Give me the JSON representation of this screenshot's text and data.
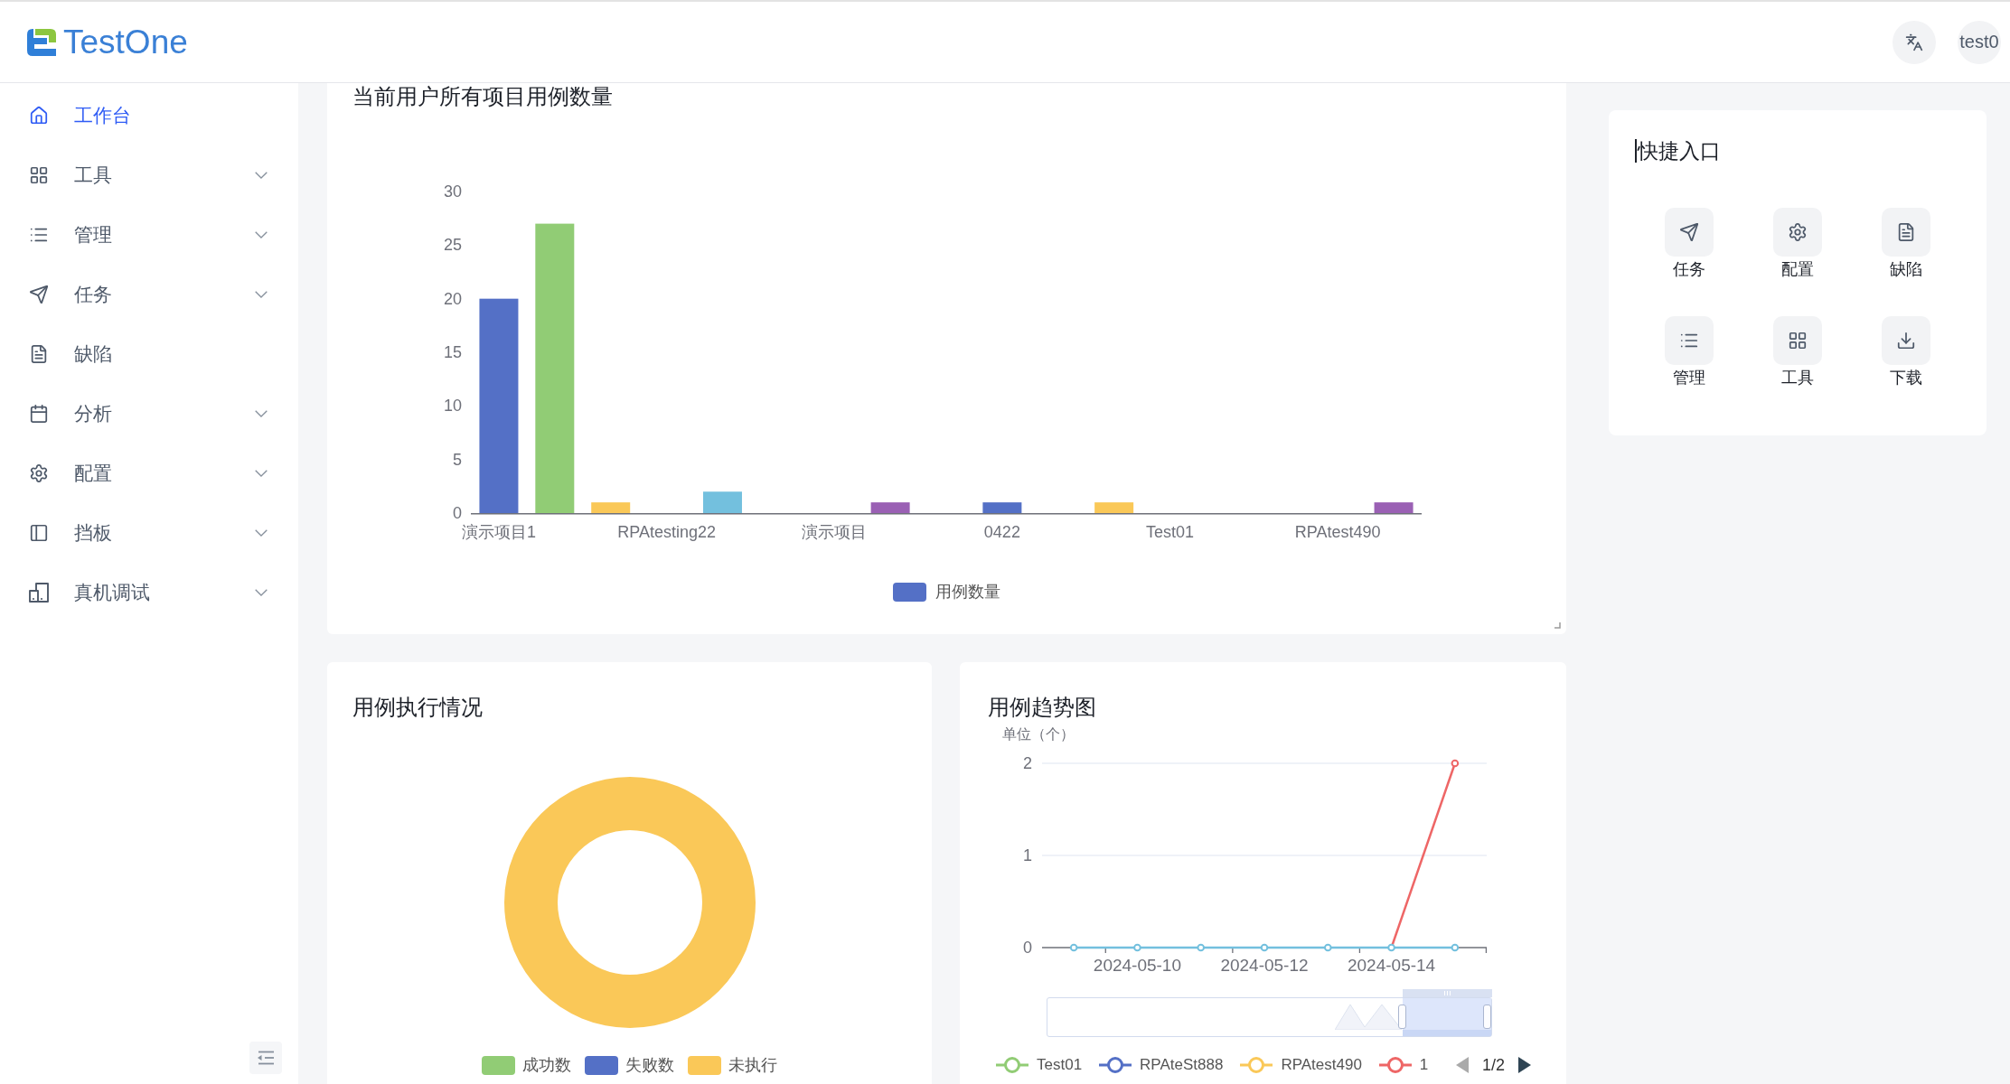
{
  "header": {
    "logo_text": "TestOne",
    "user": "test0"
  },
  "sidebar": {
    "items": [
      {
        "label": "工作台",
        "kind": "link",
        "selected": true
      },
      {
        "label": "工具",
        "kind": "submenu",
        "selected": false
      },
      {
        "label": "管理",
        "kind": "submenu",
        "selected": false
      },
      {
        "label": "任务",
        "kind": "submenu",
        "selected": false
      },
      {
        "label": "缺陷",
        "kind": "link",
        "selected": false
      },
      {
        "label": "分析",
        "kind": "submenu",
        "selected": false
      },
      {
        "label": "配置",
        "kind": "submenu",
        "selected": false
      },
      {
        "label": "挡板",
        "kind": "submenu",
        "selected": false
      },
      {
        "label": "真机调试",
        "kind": "submenu",
        "selected": false
      }
    ]
  },
  "case_count_card": {
    "chart_data": {
      "type": "bar",
      "title": "当前用户所有项目用例数量",
      "categories": [
        "演示项目1",
        null,
        null,
        "RPAtesting22",
        null,
        null,
        "演示项目",
        null,
        null,
        "0422",
        null,
        null,
        "Test01",
        null,
        null,
        "RPAtest490",
        null
      ],
      "ylim": [
        0,
        30
      ],
      "yticks": [
        0,
        5,
        10,
        15,
        20,
        25,
        30
      ],
      "series": [
        {
          "name": "用例数量",
          "color": "#5470c6",
          "values": [
            20,
            27,
            1,
            0,
            2,
            0,
            0,
            1,
            0,
            1,
            0,
            1,
            0,
            0,
            0,
            0,
            1
          ],
          "colors": [
            "#5470c6",
            "#91cc75",
            "#fac858",
            null,
            "#73c0de",
            null,
            null,
            "#9a60b4",
            null,
            "#5470c6",
            null,
            "#fac858",
            null,
            null,
            null,
            null,
            "#9a60b4"
          ]
        }
      ]
    }
  },
  "quick_entry": {
    "title": "快捷入口",
    "items": [
      {
        "label": "任务"
      },
      {
        "label": "配置"
      },
      {
        "label": "缺陷"
      },
      {
        "label": "管理"
      },
      {
        "label": "工具"
      },
      {
        "label": "下载"
      }
    ]
  },
  "execution_card": {
    "title": "用例执行情况",
    "legend": [
      {
        "label": "成功数",
        "color": "#91cc75",
        "has_slice": false
      },
      {
        "label": "失败数",
        "color": "#5470c6",
        "has_slice": false
      },
      {
        "label": "未执行",
        "color": "#fac858",
        "has_slice": true
      }
    ]
  },
  "trend_card": {
    "chart_data": {
      "type": "line",
      "title": "用例趋势图",
      "ylabel": "单位（个）",
      "categories": [
        null,
        "2024-05-10",
        null,
        "2024-05-12",
        null,
        "2024-05-14",
        null
      ],
      "ylim": [
        0,
        2
      ],
      "yticks": [
        0,
        1,
        2
      ],
      "series": [
        {
          "name": "Test01",
          "color": "#91cc75",
          "values": [
            null,
            null,
            null,
            null,
            null,
            null,
            null
          ]
        },
        {
          "name": "RPAteSt888",
          "color": "#5470c6",
          "values": [
            null,
            null,
            null,
            null,
            null,
            null,
            null
          ]
        },
        {
          "name": "RPAtest490",
          "color": "#fac858",
          "values": [
            null,
            null,
            null,
            null,
            null,
            null,
            null
          ]
        },
        {
          "name": "1",
          "color": "#ee6666",
          "marker": true,
          "values": [
            null,
            null,
            null,
            null,
            null,
            0,
            2
          ]
        },
        {
          "color": "#73c0de",
          "marker": true,
          "values": [
            0,
            0,
            0,
            0,
            0,
            0,
            0
          ]
        }
      ]
    },
    "data_zoom": {
      "level": 0.2
    },
    "legend_pager": {
      "page": "1/2",
      "prev": {
        "disabled": true
      },
      "next": {
        "disabled": false
      }
    }
  }
}
